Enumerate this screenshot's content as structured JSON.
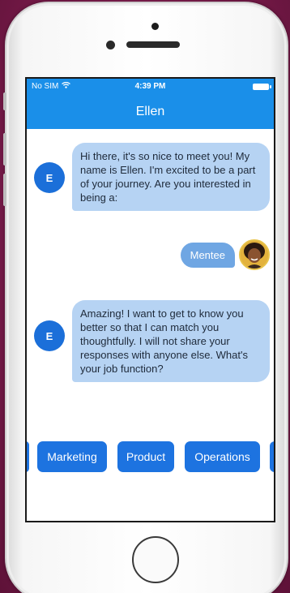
{
  "status_bar": {
    "carrier": "No SIM",
    "time": "4:39 PM",
    "wifi_icon": "wifi-icon",
    "battery_icon": "battery-icon"
  },
  "nav": {
    "title": "Ellen"
  },
  "messages": [
    {
      "from": "bot",
      "avatar_initial": "E",
      "text": "Hi there, it's so nice to meet you! My name is Ellen. I'm excited to be a part of your journey.  Are you interested in being a:"
    },
    {
      "from": "user",
      "text": "Mentee"
    },
    {
      "from": "bot",
      "avatar_initial": "E",
      "text": "Amazing! I want to get to know you better so that I can match you thoughtfully. I will not share your responses with anyone else. What's your job function?"
    }
  ],
  "quick_replies": [
    "Marketing",
    "Product",
    "Operations"
  ],
  "colors": {
    "accent": "#1a8fe9",
    "button": "#1d73e0",
    "bot_bubble": "#b6d3f3",
    "user_bubble": "#6fa6e3",
    "background": "#7d1c4d"
  }
}
